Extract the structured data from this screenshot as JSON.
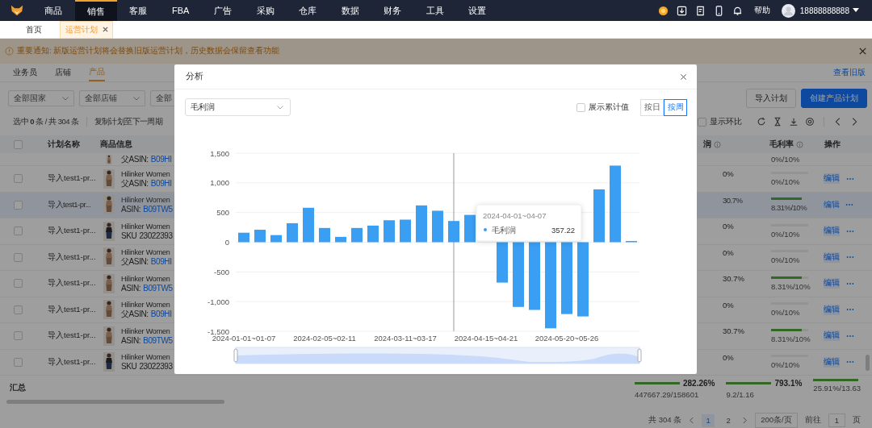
{
  "nav": {
    "items": [
      {
        "label": "商品",
        "selected": false
      },
      {
        "label": "销售",
        "selected": true
      },
      {
        "label": "客服",
        "selected": false
      },
      {
        "label": "FBA",
        "selected": false
      },
      {
        "label": "广告",
        "selected": false
      },
      {
        "label": "采购",
        "selected": false
      },
      {
        "label": "仓库",
        "selected": false
      },
      {
        "label": "数据",
        "selected": false
      },
      {
        "label": "财务",
        "selected": false
      },
      {
        "label": "工具",
        "selected": false
      },
      {
        "label": "设置",
        "selected": false
      }
    ],
    "help": "帮助",
    "user": "18888888888"
  },
  "page_tabs": [
    {
      "label": "首页",
      "selected": false,
      "closable": false
    },
    {
      "label": "运营计划",
      "selected": true,
      "closable": true
    }
  ],
  "notice": {
    "text": "重要通知: 新版运营计划将会替换旧版运营计划，历史数据会保留查看功能"
  },
  "sub_tabs": [
    {
      "label": "业务员",
      "selected": false
    },
    {
      "label": "店铺",
      "selected": false
    },
    {
      "label": "产品",
      "selected": true
    }
  ],
  "old_version_link": "查看旧版",
  "filters": [
    {
      "placeholder": "全部国家"
    },
    {
      "placeholder": "全部店铺"
    },
    {
      "placeholder": "全部"
    }
  ],
  "buttons": {
    "import": "导入计划",
    "create": "创建产品计划"
  },
  "selection": "选中 **0** 条 / 共 304 条",
  "copy_button": "复制计划至下一周期",
  "compare": {
    "label": "显示环比",
    "checked": false
  },
  "table": {
    "select_all": {
      "checked": false
    },
    "columns": [
      {
        "label": "计划名称",
        "info": false
      },
      {
        "label": "商品信息",
        "info": false
      },
      {
        "label": "润",
        "info": true
      },
      {
        "label": "毛利率",
        "info": true
      },
      {
        "label": "操作",
        "info": false
      }
    ],
    "rows": [
      {
        "kind": "asin",
        "id_label": "父ASIN:",
        "id_value": "B09HI",
        "margin": "0%/10%",
        "selected": false
      },
      {
        "name": "导入test1-pr...",
        "product": "Hilinker Women",
        "kind": "asin",
        "id_label": "父ASIN:",
        "id_value": "B09HI",
        "profit": "0%",
        "margin": "0%/10%",
        "level": 0,
        "edit": "编辑",
        "checked": false,
        "selected": false
      },
      {
        "name": "导入test1-pr...",
        "product": "Hilinker Women",
        "kind": "asin",
        "id_label": "ASIN:",
        "id_value": "B09TW5",
        "profit": "30.7%",
        "margin": "8.31%/10%",
        "level": 0.831,
        "edit": "编辑",
        "checked": false,
        "selected": true
      },
      {
        "name": "导入test1-pr...",
        "product": "Hilinker Women",
        "kind": "sku",
        "id_label": "SKU",
        "id_value": "23022393",
        "profit": "0%",
        "margin": "0%/10%",
        "level": 0,
        "edit": "编辑",
        "checked": false,
        "selected": false
      },
      {
        "name": "导入test1-pr...",
        "product": "Hilinker Women",
        "kind": "asin",
        "id_label": "父ASIN:",
        "id_value": "B09HI",
        "profit": "0%",
        "margin": "0%/10%",
        "level": 0,
        "edit": "编辑",
        "checked": false,
        "selected": false
      },
      {
        "name": "导入test1-pr...",
        "product": "Hilinker Women",
        "kind": "asin",
        "id_label": "ASIN:",
        "id_value": "B09TW5",
        "profit": "30.7%",
        "margin": "8.31%/10%",
        "level": 0.831,
        "edit": "编辑",
        "checked": false,
        "selected": false
      },
      {
        "name": "导入test1-pr...",
        "product": "Hilinker Women",
        "kind": "asin",
        "id_label": "父ASIN:",
        "id_value": "B09HI",
        "profit": "0%",
        "margin": "0%/10%",
        "level": 0,
        "edit": "编辑",
        "checked": false,
        "selected": false
      },
      {
        "name": "导入test1-pr...",
        "product": "Hilinker Women",
        "kind": "asin",
        "id_label": "ASIN:",
        "id_value": "B09TW5",
        "profit": "30.7%",
        "margin": "8.31%/10%",
        "level": 0.831,
        "edit": "编辑",
        "checked": false,
        "selected": false
      },
      {
        "name": "导入test1-pr...",
        "product": "Hilinker Women",
        "kind": "sku",
        "id_label": "SKU",
        "id_value": "23022393",
        "profit": "0%",
        "margin": "0%/10%",
        "level": 0,
        "edit": "编辑",
        "checked": false,
        "selected": false
      }
    ],
    "summary": {
      "label": "汇总",
      "cells": [
        {
          "value": "282.26%",
          "sub": "447667.29/158601",
          "level": 1
        },
        {
          "value": "793.1%",
          "sub": "9.2/1.16",
          "level": 1
        },
        {
          "sub": "25.91%/13.63",
          "level": 1
        }
      ]
    }
  },
  "pagination": {
    "total": "共 304 条",
    "pages": [
      {
        "label": "1",
        "selected": true
      },
      {
        "label": "2",
        "selected": false
      }
    ],
    "page_size": "200条/页",
    "goto": "前往",
    "page_input": "1",
    "page_unit": "页"
  },
  "modal": {
    "title": "分析",
    "metric": "毛利润",
    "cumulative": {
      "label": "展示累计值",
      "checked": false
    },
    "periods": [
      {
        "label": "按日",
        "selected": false
      },
      {
        "label": "按周",
        "selected": true
      }
    ],
    "chart_data": {
      "type": "bar",
      "grid": true,
      "categories": [
        "2024-01-01~01-07",
        null,
        null,
        null,
        null,
        "2024-02-05~02-11",
        null,
        null,
        null,
        null,
        "2024-03-11~03-17",
        null,
        null,
        null,
        null,
        "2024-04-15~04-21",
        null,
        null,
        null,
        null,
        "2024-05-20~05-26",
        null,
        null,
        null,
        null
      ],
      "series": [
        {
          "name": "毛利润",
          "color": "#3a9ef2",
          "values": [
            160,
            210,
            120,
            320,
            580,
            240,
            90,
            240,
            280,
            370,
            380,
            620,
            530,
            357.22,
            460,
            null,
            -680,
            -1090,
            -1140,
            -1450,
            -1210,
            -1250,
            890,
            1290,
            20
          ]
        }
      ],
      "ylim": [
        -1500,
        1500
      ],
      "yticks": [
        {
          "value": -1500,
          "label": "-1,500"
        },
        {
          "value": -1000,
          "label": "-1,000"
        },
        {
          "value": -500,
          "label": "-500"
        },
        {
          "value": 0,
          "label": "0"
        },
        {
          "value": 500,
          "label": "500"
        },
        {
          "value": 1000,
          "label": "1,000"
        },
        {
          "value": 1500,
          "label": "1,500"
        }
      ]
    },
    "tooltip": {
      "title": "2024-04-01~04-07",
      "value": "357.22"
    }
  }
}
